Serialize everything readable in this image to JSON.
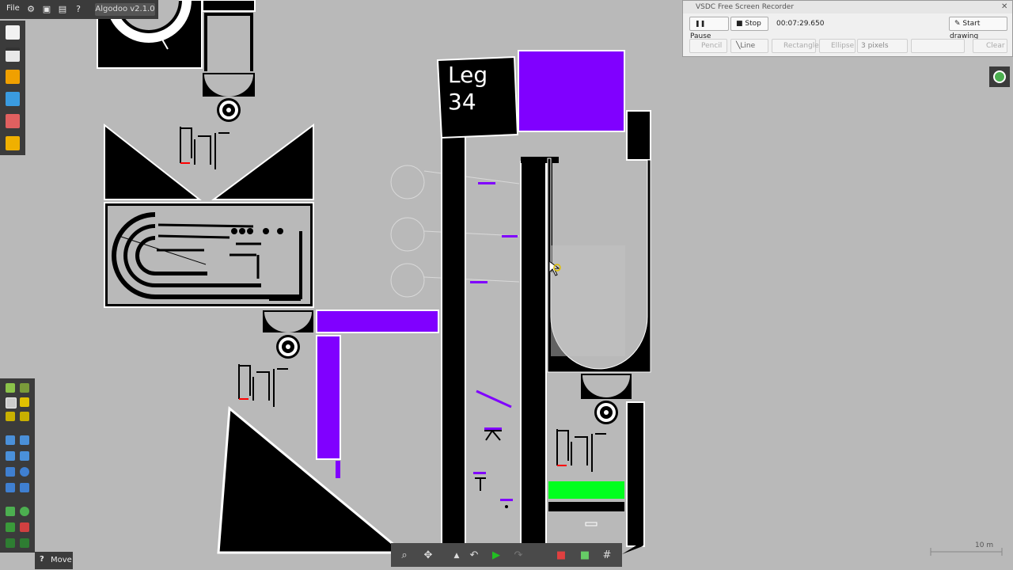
{
  "app": {
    "title": "Algodoo v2.1.0",
    "menu_file": "File"
  },
  "scene": {
    "leg_sign_line1": "Leg",
    "leg_sign_line2": "34",
    "scale_label": "10 m",
    "colors": {
      "background": "#b9b9b9",
      "accent_purple": "#8000ff",
      "green_block": "#00ff1e",
      "black": "#000000"
    }
  },
  "tools": {
    "move_label": "Move",
    "help_icon": "?"
  },
  "recorder": {
    "title": "VSDC Free Screen Recorder",
    "pause_label": "Pause",
    "stop_label": "Stop",
    "timer": "00:07:29.650",
    "start_drawing_label": "Start drawing",
    "pencil_label": "Pencil",
    "line_label": "Line",
    "rectangle_label": "Rectangle",
    "ellipse_label": "Ellipse",
    "pixels_value": "3 pixels",
    "clear_label": "Clear"
  }
}
